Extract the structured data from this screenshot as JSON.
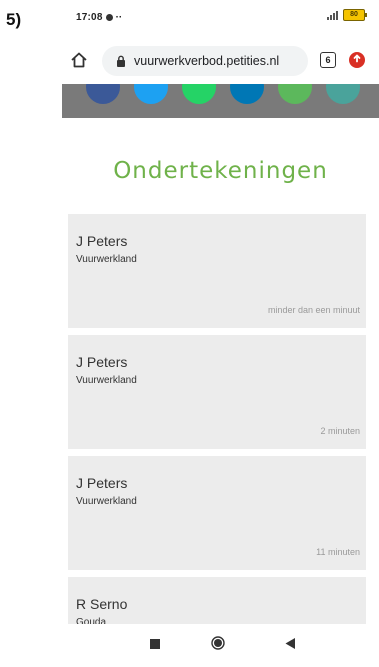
{
  "step": {
    "label": "5)"
  },
  "status_bar": {
    "time": "17:08",
    "overflow": "··",
    "battery": "80"
  },
  "browser": {
    "url": "vuurwerkverbod.petities.nl",
    "tab_count": "6"
  },
  "share_buttons": [
    {
      "icon": "facebook-icon",
      "color": "#3b5998"
    },
    {
      "icon": "twitter-icon",
      "color": "#1da1f2"
    },
    {
      "icon": "whatsapp-icon",
      "color": "#25d366"
    },
    {
      "icon": "linkedin-icon",
      "color": "#0077b5"
    },
    {
      "icon": "email-icon",
      "color": "#5cb85c"
    },
    {
      "icon": "link-icon",
      "color": "#4aa39b"
    }
  ],
  "section": {
    "title": "Ondertekeningen",
    "title_color": "#6fb24a"
  },
  "signatures": [
    {
      "name": "J Peters",
      "place": "Vuurwerkland",
      "time": "minder dan een minuut"
    },
    {
      "name": "J Peters",
      "place": "Vuurwerkland",
      "time": "2 minuten"
    },
    {
      "name": "J Peters",
      "place": "Vuurwerkland",
      "time": "11 minuten"
    },
    {
      "name": "R Serno",
      "place": "Gouda",
      "time": ""
    }
  ],
  "colors": {
    "card_background": "#ececec",
    "banner_background": "#7a7a7a"
  }
}
